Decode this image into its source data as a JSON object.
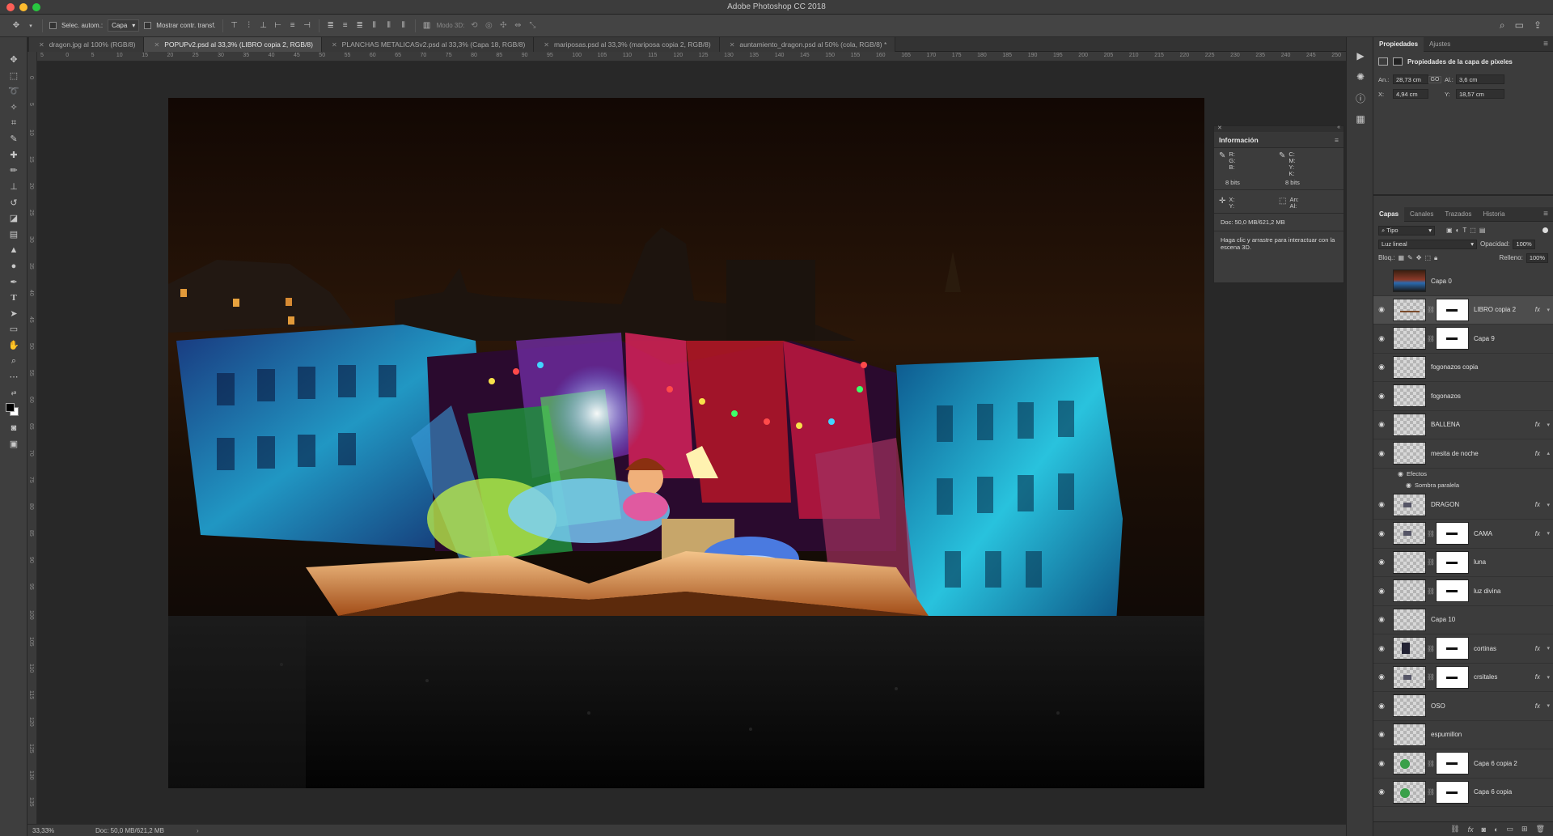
{
  "app": {
    "title": "Adobe Photoshop CC 2018"
  },
  "options_bar": {
    "auto_select_label": "Selec. autom.:",
    "auto_select_value": "Capa",
    "show_transform_label": "Mostrar contr. transf.",
    "mode_3d_label": "Modo 3D:"
  },
  "tabs": [
    {
      "label": "dragon.jpg al 100% (RGB/8)",
      "active": false
    },
    {
      "label": "POPUPv2.psd al 33,3% (LIBRO copia 2, RGB/8)",
      "active": true
    },
    {
      "label": "PLANCHAS METALICASv2.psd al 33,3% (Capa 18, RGB/8)",
      "active": false
    },
    {
      "label": "mariposas.psd al 33,3% (mariposa copia 2, RGB/8)",
      "active": false
    },
    {
      "label": "auntamiento_dragon.psd al 50% (cola, RGB/8) *",
      "active": false
    }
  ],
  "ruler_h": [
    "5",
    "0",
    "5",
    "10",
    "15",
    "20",
    "25",
    "30",
    "35",
    "40",
    "45",
    "50",
    "55",
    "60",
    "65",
    "70",
    "75",
    "80",
    "85",
    "90",
    "95",
    "100",
    "105",
    "110",
    "115",
    "120",
    "125",
    "130",
    "135",
    "140",
    "145",
    "150",
    "155",
    "160",
    "165",
    "170",
    "175",
    "180",
    "185",
    "190",
    "195",
    "200",
    "205",
    "210",
    "215",
    "220",
    "225",
    "230",
    "235",
    "240",
    "245",
    "250",
    "255"
  ],
  "ruler_v": [
    "0",
    "5",
    "10",
    "15",
    "20",
    "25",
    "30",
    "35",
    "40",
    "45",
    "50",
    "55",
    "60",
    "65",
    "70",
    "75",
    "80",
    "85",
    "90",
    "95",
    "100",
    "105",
    "110",
    "115",
    "120",
    "125",
    "130",
    "135"
  ],
  "status": {
    "zoom": "33,33%",
    "doc": "Doc: 50,0 MB/621,2 MB"
  },
  "info_panel": {
    "title": "Información",
    "rgb_labels": [
      "R:",
      "G:",
      "B:"
    ],
    "cmyk_labels": [
      "C:",
      "M:",
      "Y:",
      "K:"
    ],
    "bits_left": "8 bits",
    "bits_right": "8 bits",
    "xy_labels": [
      "X:",
      "Y:"
    ],
    "wh_labels": [
      "An:",
      "Al:"
    ],
    "doc": "Doc: 50,0 MB/621,2 MB",
    "hint": "Haga clic y arrastre para interactuar con la escena 3D."
  },
  "properties": {
    "tabs": [
      "Propiedades",
      "Ajustes"
    ],
    "heading": "Propiedades de la capa de píxeles",
    "w_label": "An.:",
    "w_value": "28,73 cm",
    "link_label": "GO",
    "h_label": "Al.:",
    "h_value": "3,6 cm",
    "x_label": "X:",
    "x_value": "4,94 cm",
    "y_label": "Y:",
    "y_value": "18,57 cm"
  },
  "layers_panel": {
    "tabs": [
      "Capas",
      "Canales",
      "Trazados",
      "Historia"
    ],
    "filter": "Tipo",
    "blend_mode": "Luz lineal",
    "opacity_label": "Opacidad:",
    "opacity_value": "100%",
    "lock_label": "Bloq.:",
    "fill_label": "Relleno:",
    "fill_value": "100%",
    "effects_label": "Efectos",
    "effect_name": "Sombra paralela",
    "layers": [
      {
        "name": "Capa 0",
        "visible": false,
        "mask": false,
        "fx": false,
        "thumb": "photo"
      },
      {
        "name": "LIBRO copia 2",
        "visible": true,
        "mask": true,
        "fx": true,
        "selected": true,
        "thumb": "line"
      },
      {
        "name": "Capa 9",
        "visible": true,
        "mask": true,
        "fx": false,
        "thumb": "empty"
      },
      {
        "name": "fogonazos copia",
        "visible": true,
        "mask": false,
        "fx": false,
        "thumb": "empty"
      },
      {
        "name": "fogonazos",
        "visible": true,
        "mask": false,
        "fx": false,
        "thumb": "empty"
      },
      {
        "name": "BALLENA",
        "visible": true,
        "mask": false,
        "fx": true,
        "thumb": "empty"
      },
      {
        "name": "mesita de noche",
        "visible": true,
        "mask": false,
        "fx": true,
        "expanded": true,
        "thumb": "empty"
      },
      {
        "name": "DRAGON",
        "visible": true,
        "mask": false,
        "fx": true,
        "thumb": "dot"
      },
      {
        "name": "CAMA",
        "visible": true,
        "mask": true,
        "fx": true,
        "thumb": "dot"
      },
      {
        "name": "luna",
        "visible": true,
        "mask": true,
        "fx": false,
        "thumb": "empty"
      },
      {
        "name": "luz divina",
        "visible": true,
        "mask": true,
        "fx": false,
        "thumb": "empty"
      },
      {
        "name": "Capa 10",
        "visible": true,
        "mask": false,
        "fx": false,
        "thumb": "empty"
      },
      {
        "name": "cortinas",
        "visible": true,
        "mask": true,
        "fx": true,
        "thumb": "dark"
      },
      {
        "name": "crsitales",
        "visible": true,
        "mask": true,
        "fx": true,
        "thumb": "dot"
      },
      {
        "name": "OSO",
        "visible": true,
        "mask": false,
        "fx": true,
        "thumb": "empty"
      },
      {
        "name": "espumillon",
        "visible": true,
        "mask": false,
        "fx": false,
        "thumb": "empty"
      },
      {
        "name": "Capa 6 copia 2",
        "visible": true,
        "mask": true,
        "fx": false,
        "thumb": "green"
      },
      {
        "name": "Capa 6 copia",
        "visible": true,
        "mask": true,
        "fx": false,
        "thumb": "green"
      }
    ]
  },
  "colors": {
    "accent_eye": "#d6d6d6",
    "panel_bg": "#3c3c3c",
    "canvas_bg": "#282828"
  }
}
